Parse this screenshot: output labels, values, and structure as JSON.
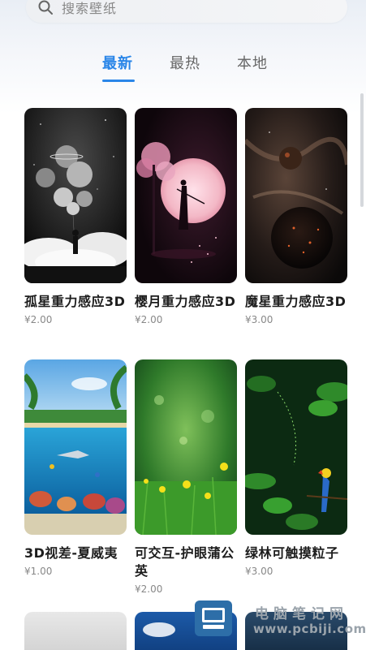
{
  "search": {
    "placeholder": "搜索壁纸",
    "icon": "search-icon"
  },
  "tabs": [
    {
      "label": "最新",
      "active": true
    },
    {
      "label": "最热",
      "active": false
    },
    {
      "label": "本地",
      "active": false
    }
  ],
  "accent_color": "#2a86e8",
  "wallpapers": [
    {
      "title": "孤星重力感应3D",
      "price": "¥2.00"
    },
    {
      "title": "樱月重力感应3D",
      "price": "¥2.00"
    },
    {
      "title": "魔星重力感应3D",
      "price": "¥3.00"
    },
    {
      "title": "3D视差-夏威夷",
      "price": "¥1.00"
    },
    {
      "title": "可交互-护眼蒲公英",
      "price": "¥2.00"
    },
    {
      "title": "绿林可触摸粒子",
      "price": "¥3.00"
    }
  ],
  "watermark": {
    "site_name": "电脑笔记网",
    "url": "www.pcbiji.com"
  }
}
